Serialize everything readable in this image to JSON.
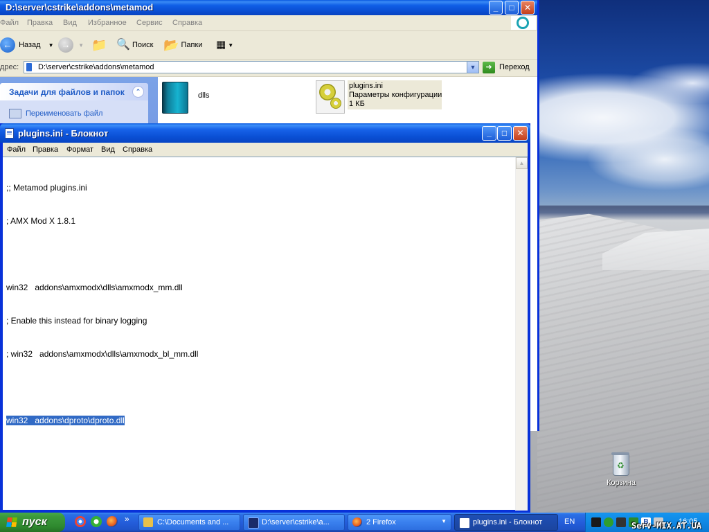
{
  "explorer": {
    "title": "D:\\server\\cstrike\\addons\\metamod",
    "menu": [
      "Файл",
      "Правка",
      "Вид",
      "Избранное",
      "Сервис",
      "Справка"
    ],
    "toolbar": {
      "back_label": "Назад",
      "search_label": "Поиск",
      "folders_label": "Папки"
    },
    "address": {
      "label": "дрес:",
      "value": "D:\\server\\cstrike\\addons\\metamod",
      "go_label": "Переход"
    },
    "taskpane": {
      "heading": "Задачи для файлов и папок",
      "link": "Переименовать файл"
    },
    "files": [
      {
        "name": "dlls",
        "icon": "folder-icon"
      },
      {
        "name": "plugins.ini",
        "type": "Параметры конфигурации",
        "size": "1 КБ",
        "icon": "config-file-icon"
      }
    ]
  },
  "notepad": {
    "title": "plugins.ini - Блокнот",
    "menu": [
      "Файл",
      "Правка",
      "Формат",
      "Вид",
      "Справка"
    ],
    "lines": [
      ";; Metamod plugins.ini",
      "; AMX Mod X 1.8.1",
      "",
      "win32   addons\\amxmodx\\dlls\\amxmodx_mm.dll",
      "; Enable this instead for binary logging",
      "; win32   addons\\amxmodx\\dlls\\amxmodx_bl_mm.dll",
      "",
      "win32   addons\\dproto\\dproto.dll"
    ],
    "selected_line_index": 7
  },
  "desktop": {
    "recycle_bin_label": "Корзина"
  },
  "taskbar": {
    "start_label": "пуск",
    "items": [
      {
        "label": "C:\\Documents and ...",
        "active": false
      },
      {
        "label": "D:\\server\\cstrike\\a...",
        "active": false
      },
      {
        "label": "2 Firefox",
        "active": false
      },
      {
        "label": "plugins.ini - Блокнот",
        "active": true
      }
    ],
    "language": "EN",
    "clock": "16:05",
    "overflow_glyph": "»"
  },
  "watermark": "Serv-MIX.AT.UA",
  "colors": {
    "titlebar": "#0a4fd4",
    "taskbar": "#245edb",
    "start_button": "#3c9a3c",
    "selection": "#316ac5",
    "taskpane_link": "#215dc6"
  }
}
